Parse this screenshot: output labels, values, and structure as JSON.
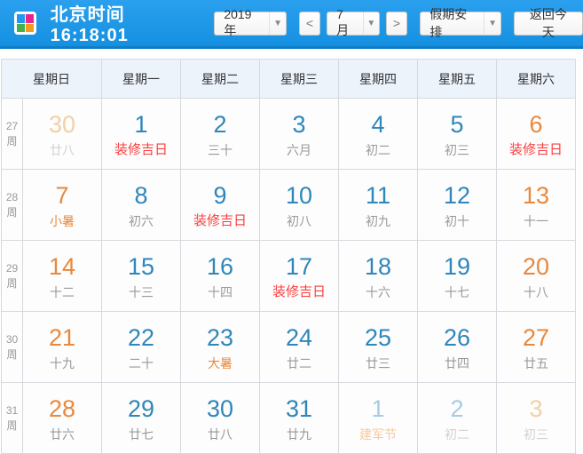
{
  "colors": {
    "bar_top": "#2aa0ee",
    "bar_bottom": "#1590e0",
    "bar_edge": "#0d7ec6",
    "header_bg": "#edf3fb",
    "grid_line": "#d6d9dd",
    "table_border": "#c6cbd2",
    "num_blue": "#2e86ba",
    "num_orange": "#e8883c",
    "num_dim_orange": "#f2d0a4",
    "num_dim_blue": "#a6cbe4",
    "lunar_gray": "#999999",
    "lunar_red": "#fa3e3e",
    "lunar_orange": "#e8883c",
    "lunar_dim": "#d2d2d2",
    "lunar_dim_orange": "#f4cc9e"
  },
  "topbar": {
    "logo_icon": "four-color-grid",
    "time": "北京时间 16:18:01",
    "year": "2019年",
    "prev": "<",
    "month": "7月",
    "next": ">",
    "holiday": "假期安排",
    "today": "返回今天",
    "dropdown_arrow": "▼"
  },
  "calendar": {
    "weekday_headers": [
      "星期日",
      "星期一",
      "星期二",
      "星期三",
      "星期四",
      "星期五",
      "星期六"
    ],
    "weeks": [
      {
        "label": "27周",
        "days": [
          {
            "num": "30",
            "lunar": "廿八",
            "num_style": "dim-orange",
            "lunar_style": "dim"
          },
          {
            "num": "1",
            "lunar": "装修吉日",
            "num_style": "blue",
            "lunar_style": "red"
          },
          {
            "num": "2",
            "lunar": "三十",
            "num_style": "blue",
            "lunar_style": "gray"
          },
          {
            "num": "3",
            "lunar": "六月",
            "num_style": "blue",
            "lunar_style": "gray"
          },
          {
            "num": "4",
            "lunar": "初二",
            "num_style": "blue",
            "lunar_style": "gray"
          },
          {
            "num": "5",
            "lunar": "初三",
            "num_style": "blue",
            "lunar_style": "gray"
          },
          {
            "num": "6",
            "lunar": "装修吉日",
            "num_style": "orange",
            "lunar_style": "red"
          }
        ]
      },
      {
        "label": "28周",
        "days": [
          {
            "num": "7",
            "lunar": "小暑",
            "num_style": "orange",
            "lunar_style": "orange"
          },
          {
            "num": "8",
            "lunar": "初六",
            "num_style": "blue",
            "lunar_style": "gray"
          },
          {
            "num": "9",
            "lunar": "装修吉日",
            "num_style": "blue",
            "lunar_style": "red"
          },
          {
            "num": "10",
            "lunar": "初八",
            "num_style": "blue",
            "lunar_style": "gray"
          },
          {
            "num": "11",
            "lunar": "初九",
            "num_style": "blue",
            "lunar_style": "gray"
          },
          {
            "num": "12",
            "lunar": "初十",
            "num_style": "blue",
            "lunar_style": "gray"
          },
          {
            "num": "13",
            "lunar": "十一",
            "num_style": "orange",
            "lunar_style": "gray"
          }
        ]
      },
      {
        "label": "29周",
        "days": [
          {
            "num": "14",
            "lunar": "十二",
            "num_style": "orange",
            "lunar_style": "gray"
          },
          {
            "num": "15",
            "lunar": "十三",
            "num_style": "blue",
            "lunar_style": "gray"
          },
          {
            "num": "16",
            "lunar": "十四",
            "num_style": "blue",
            "lunar_style": "gray"
          },
          {
            "num": "17",
            "lunar": "装修吉日",
            "num_style": "blue",
            "lunar_style": "red"
          },
          {
            "num": "18",
            "lunar": "十六",
            "num_style": "blue",
            "lunar_style": "gray"
          },
          {
            "num": "19",
            "lunar": "十七",
            "num_style": "blue",
            "lunar_style": "gray"
          },
          {
            "num": "20",
            "lunar": "十八",
            "num_style": "orange",
            "lunar_style": "gray"
          }
        ]
      },
      {
        "label": "30周",
        "days": [
          {
            "num": "21",
            "lunar": "十九",
            "num_style": "orange",
            "lunar_style": "gray"
          },
          {
            "num": "22",
            "lunar": "二十",
            "num_style": "blue",
            "lunar_style": "gray"
          },
          {
            "num": "23",
            "lunar": "大暑",
            "num_style": "blue",
            "lunar_style": "orange"
          },
          {
            "num": "24",
            "lunar": "廿二",
            "num_style": "blue",
            "lunar_style": "gray"
          },
          {
            "num": "25",
            "lunar": "廿三",
            "num_style": "blue",
            "lunar_style": "gray"
          },
          {
            "num": "26",
            "lunar": "廿四",
            "num_style": "blue",
            "lunar_style": "gray"
          },
          {
            "num": "27",
            "lunar": "廿五",
            "num_style": "orange",
            "lunar_style": "gray"
          }
        ]
      },
      {
        "label": "31周",
        "days": [
          {
            "num": "28",
            "lunar": "廿六",
            "num_style": "orange",
            "lunar_style": "gray"
          },
          {
            "num": "29",
            "lunar": "廿七",
            "num_style": "blue",
            "lunar_style": "gray"
          },
          {
            "num": "30",
            "lunar": "廿八",
            "num_style": "blue",
            "lunar_style": "gray"
          },
          {
            "num": "31",
            "lunar": "廿九",
            "num_style": "blue",
            "lunar_style": "gray"
          },
          {
            "num": "1",
            "lunar": "建军节",
            "num_style": "dim-blue",
            "lunar_style": "dim-orange"
          },
          {
            "num": "2",
            "lunar": "初二",
            "num_style": "dim-blue",
            "lunar_style": "dim"
          },
          {
            "num": "3",
            "lunar": "初三",
            "num_style": "dim-orange",
            "lunar_style": "dim"
          }
        ]
      }
    ]
  }
}
